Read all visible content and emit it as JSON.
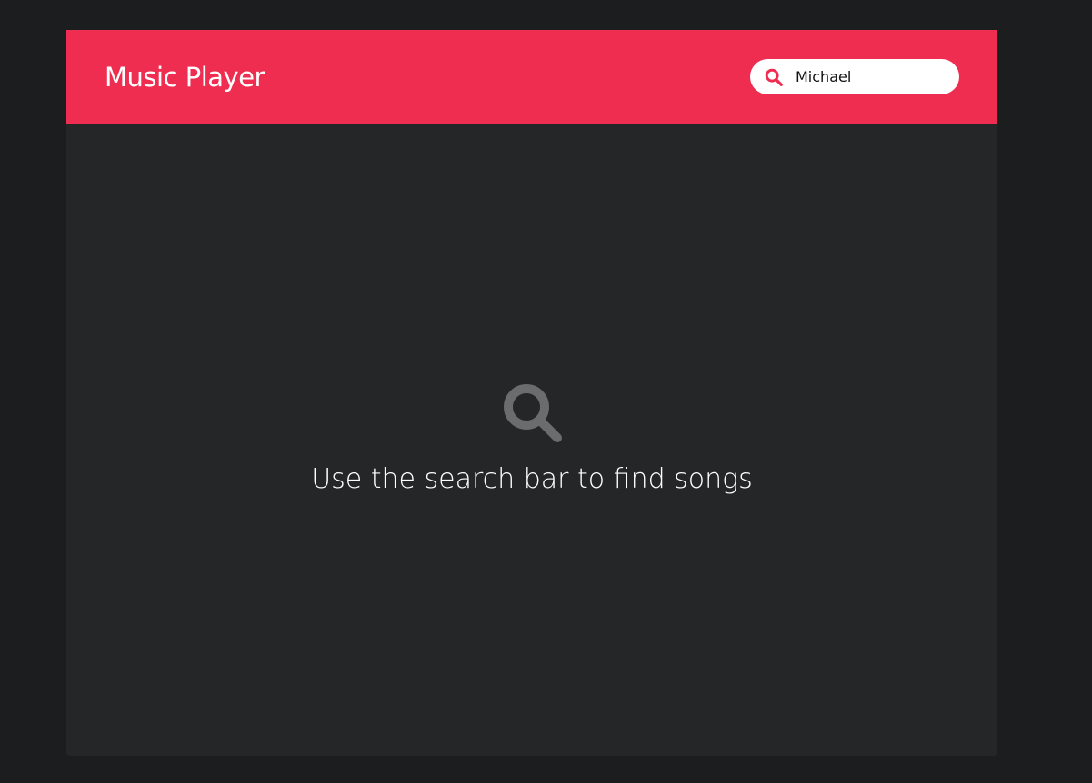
{
  "app": {
    "title": "Music Player"
  },
  "search": {
    "value": "Michael",
    "icon": "search-icon"
  },
  "empty_state": {
    "icon": "search-icon",
    "message": "Use the search bar to find songs"
  },
  "colors": {
    "accent": "#ef2d50",
    "panel_background": "#252628",
    "page_background": "#1c1d1f",
    "empty_icon": "#6b6c6e"
  }
}
